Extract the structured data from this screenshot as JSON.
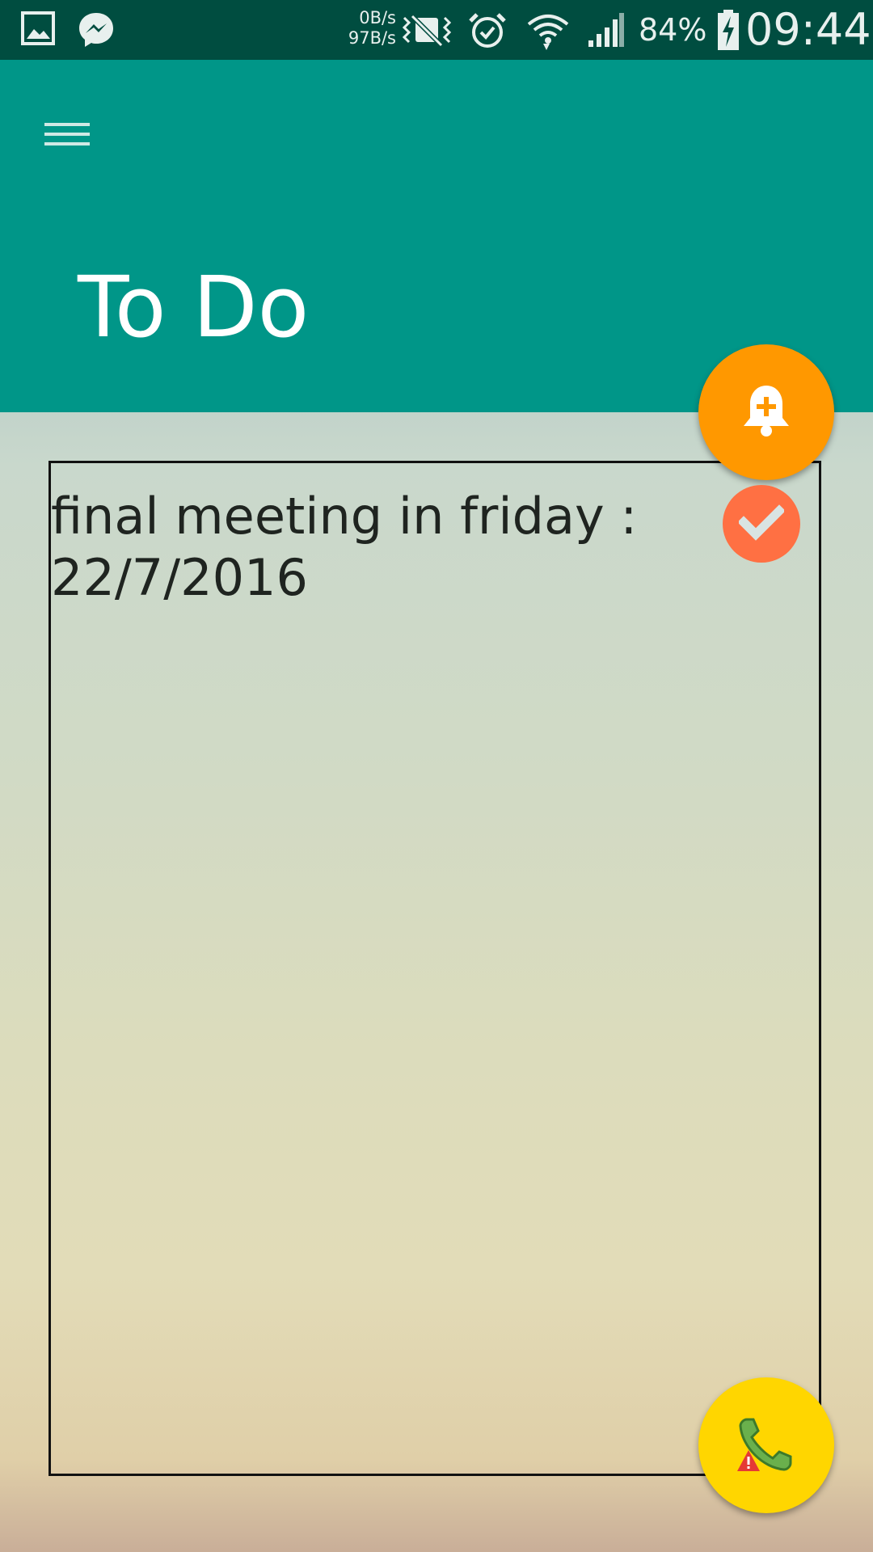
{
  "status_bar": {
    "net_speed_down": "0B/s",
    "net_speed_up": "97B/s",
    "battery_percent": "84%",
    "time": "09:44",
    "icons": [
      "gallery-icon",
      "messenger-icon",
      "vibrate-off-icon",
      "alarm-icon",
      "wifi-icon",
      "signal-icon",
      "battery-charging-icon"
    ]
  },
  "app_bar": {
    "menu_icon": "hamburger-menu-icon",
    "title": "To Do",
    "background_color": "#009688"
  },
  "note": {
    "text": "final meeting in friday :\n22/7/2016"
  },
  "fabs": {
    "reminder": {
      "icon": "bell-plus-icon",
      "color": "#ff9800"
    },
    "done": {
      "icon": "check-icon",
      "color": "#ff7043"
    },
    "call": {
      "icon": "phone-alert-icon",
      "color": "#ffd600"
    }
  }
}
